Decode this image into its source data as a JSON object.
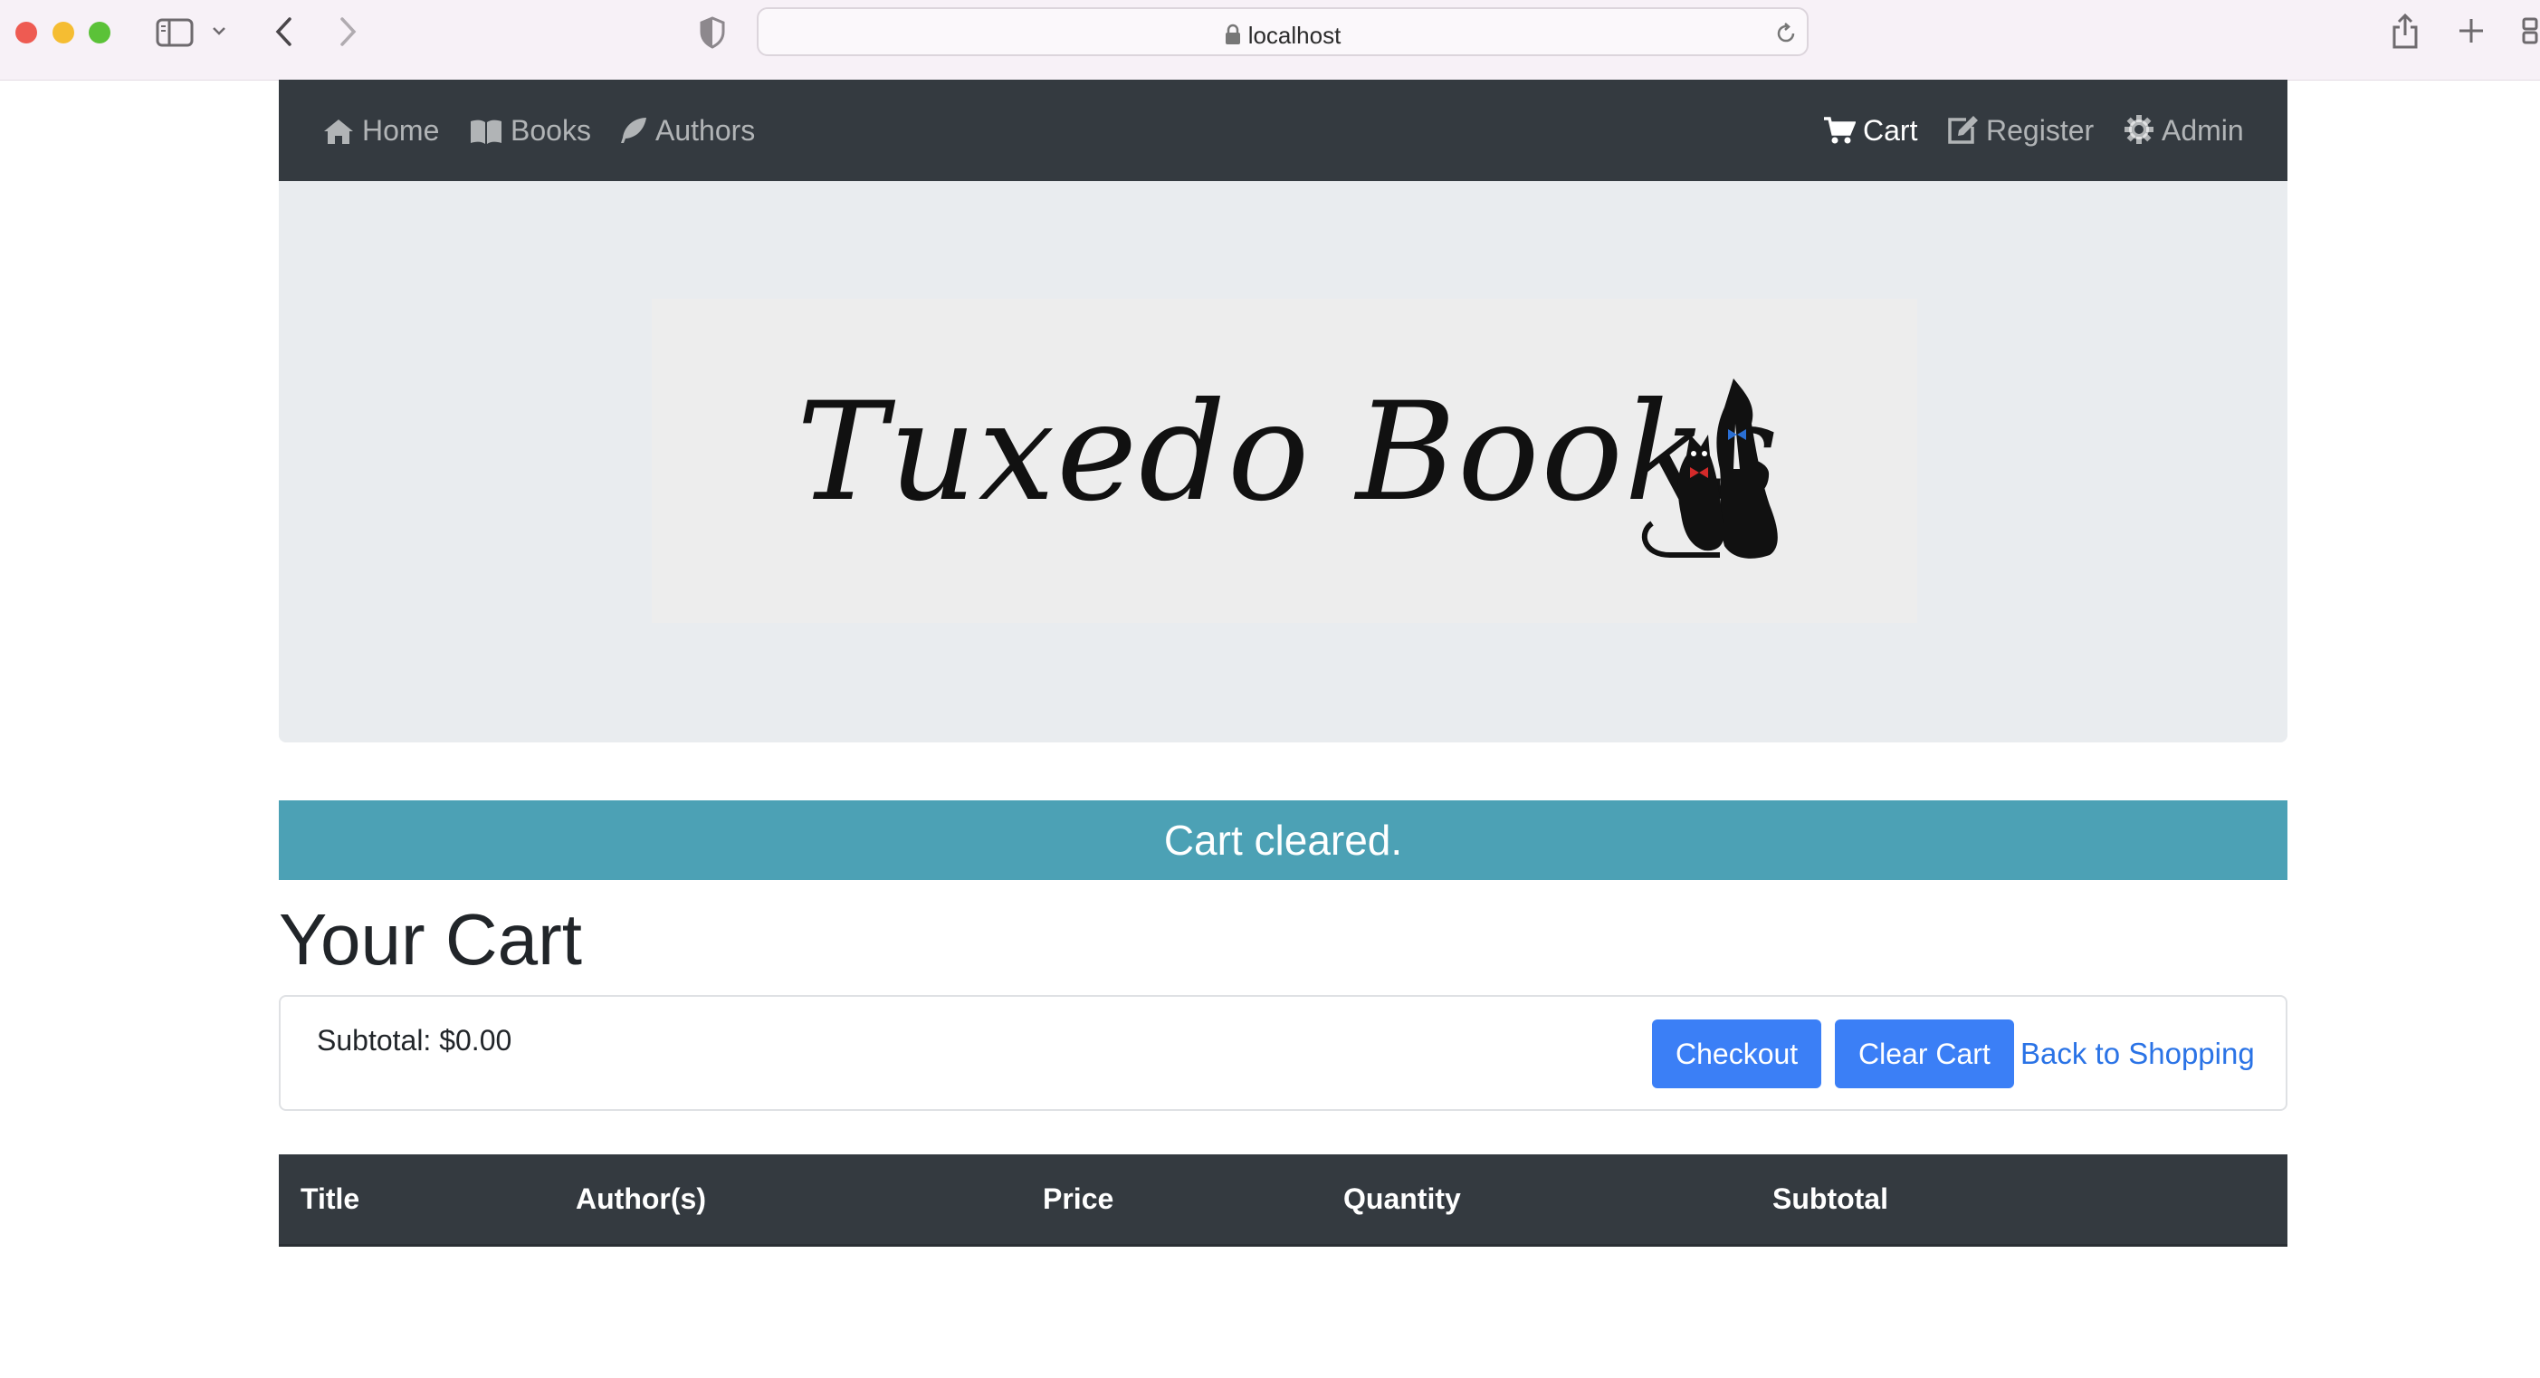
{
  "browser": {
    "url": "localhost"
  },
  "navbar": {
    "left_items": [
      {
        "label": "Home",
        "icon": "home-icon"
      },
      {
        "label": "Books",
        "icon": "book-open-icon"
      },
      {
        "label": "Authors",
        "icon": "feather-icon"
      }
    ],
    "right_items": [
      {
        "label": "Cart",
        "icon": "cart-icon",
        "active": true
      },
      {
        "label": "Register",
        "icon": "edit-icon"
      },
      {
        "label": "Admin",
        "icon": "gear-icon"
      }
    ]
  },
  "banner": {
    "logo_text": "Tuxedo Books",
    "logo_icon": "tuxedo-cats-logo"
  },
  "alert": {
    "message": "Cart cleared."
  },
  "cart": {
    "title": "Your Cart",
    "subtotal_label": "Subtotal: $0.00",
    "checkout_label": "Checkout",
    "clear_label": "Clear Cart",
    "back_label": "Back to Shopping"
  },
  "table": {
    "columns": [
      "Title",
      "Author(s)",
      "Price",
      "Quantity",
      "Subtotal"
    ],
    "rows": []
  },
  "colors": {
    "navbar": "#343a40",
    "alert": "#4ca1b5",
    "primary": "#3b7ff6",
    "link": "#2a73e6"
  }
}
